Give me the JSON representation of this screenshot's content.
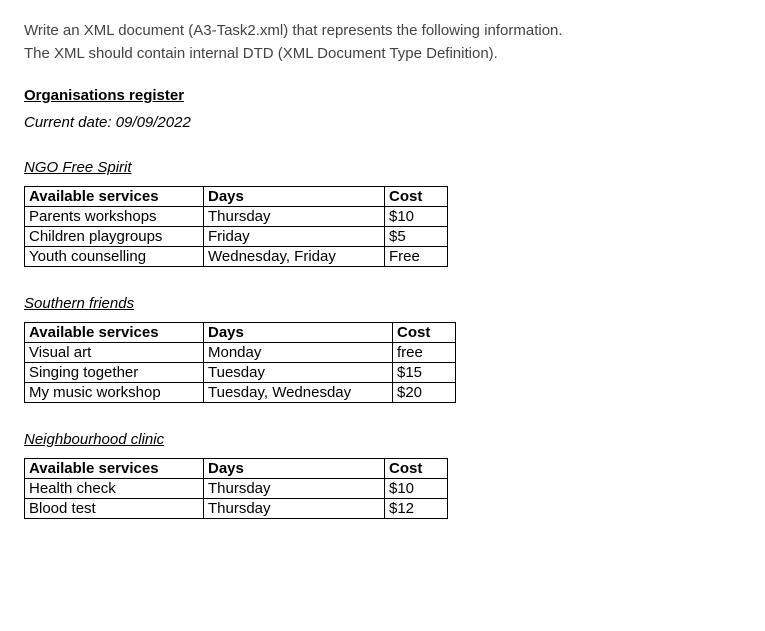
{
  "intro": {
    "line1": "Write an XML document (A3-Task2.xml) that represents the following information.",
    "line2": "The XML should contain internal DTD (XML Document Type Definition)."
  },
  "register": {
    "title": "Organisations register",
    "current_date_label": "Current date: 09/09/2022"
  },
  "headers": {
    "service": "Available services",
    "days": "Days",
    "cost": "Cost"
  },
  "orgs": [
    {
      "name": "NGO Free Spirit",
      "rows": [
        {
          "service": "Parents workshops",
          "days": "Thursday",
          "cost": "$10"
        },
        {
          "service": "Children playgroups",
          "days": "Friday",
          "cost": "$5"
        },
        {
          "service": "Youth counselling",
          "days": "Wednesday, Friday",
          "cost": "Free"
        }
      ]
    },
    {
      "name": "Southern friends",
      "rows": [
        {
          "service": "Visual art",
          "days": "Monday",
          "cost": "free"
        },
        {
          "service": "Singing together",
          "days": "Tuesday",
          "cost": "$15"
        },
        {
          "service": "My music workshop",
          "days": "Tuesday, Wednesday",
          "cost": "$20"
        }
      ]
    },
    {
      "name": "Neighbourhood clinic",
      "rows": [
        {
          "service": "Health check",
          "days": "Thursday",
          "cost": "$10"
        },
        {
          "service": "Blood test",
          "days": "Thursday",
          "cost": "$12"
        }
      ]
    }
  ]
}
